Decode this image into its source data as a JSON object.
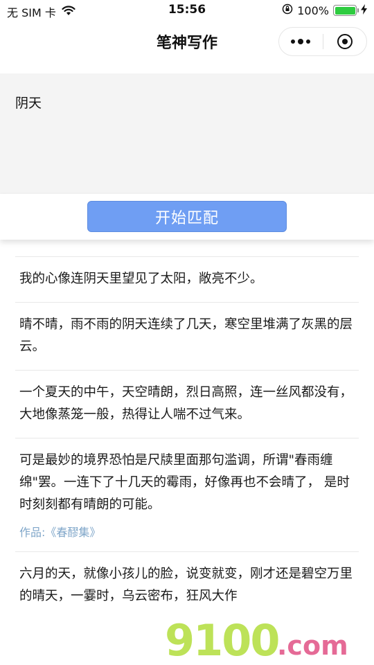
{
  "status_bar": {
    "carrier": "无 SIM 卡",
    "time": "15:56",
    "battery_percent": "100%",
    "battery_level": 1.0,
    "icons": [
      "wifi-icon",
      "orientation-lock-icon",
      "battery-icon",
      "charging-icon"
    ]
  },
  "nav": {
    "title": "笔神写作",
    "capsule_icons": [
      "more-icon",
      "close-target-icon"
    ]
  },
  "input": {
    "value": "阴天"
  },
  "action": {
    "match_label": "开始匹配"
  },
  "results": [
    {
      "text": "我的心像连阴天里望见了太阳，敞亮不少。"
    },
    {
      "text": "晴不晴，雨不雨的阴天连续了几天，寒空里堆满了灰黑的层云。"
    },
    {
      "text": "一个夏天的中午，天空晴朗，烈日高照，连一丝风都没有，大地像蒸笼一般，热得让人喘不过气来。"
    },
    {
      "text": "可是最妙的境界恐怕是尺牍里面那句滥调，所谓\"春雨缠绵\"罢。一连下了十几天的霉雨，好像再也不会晴了， 是时时刻刻都有晴朗的可能。",
      "source": "作品:《春醪集》"
    },
    {
      "text": "六月的天，就像小孩儿的脸，说变就变，刚才还是碧空万里的晴天，一霎时，乌云密布，狂风大作"
    }
  ],
  "watermark": {
    "brand_number": "9100",
    "brand_suffix": ".com"
  },
  "colors": {
    "accent": "#6f9ef3",
    "source_text": "#7fa6c9",
    "battery": "#2ecc40"
  }
}
